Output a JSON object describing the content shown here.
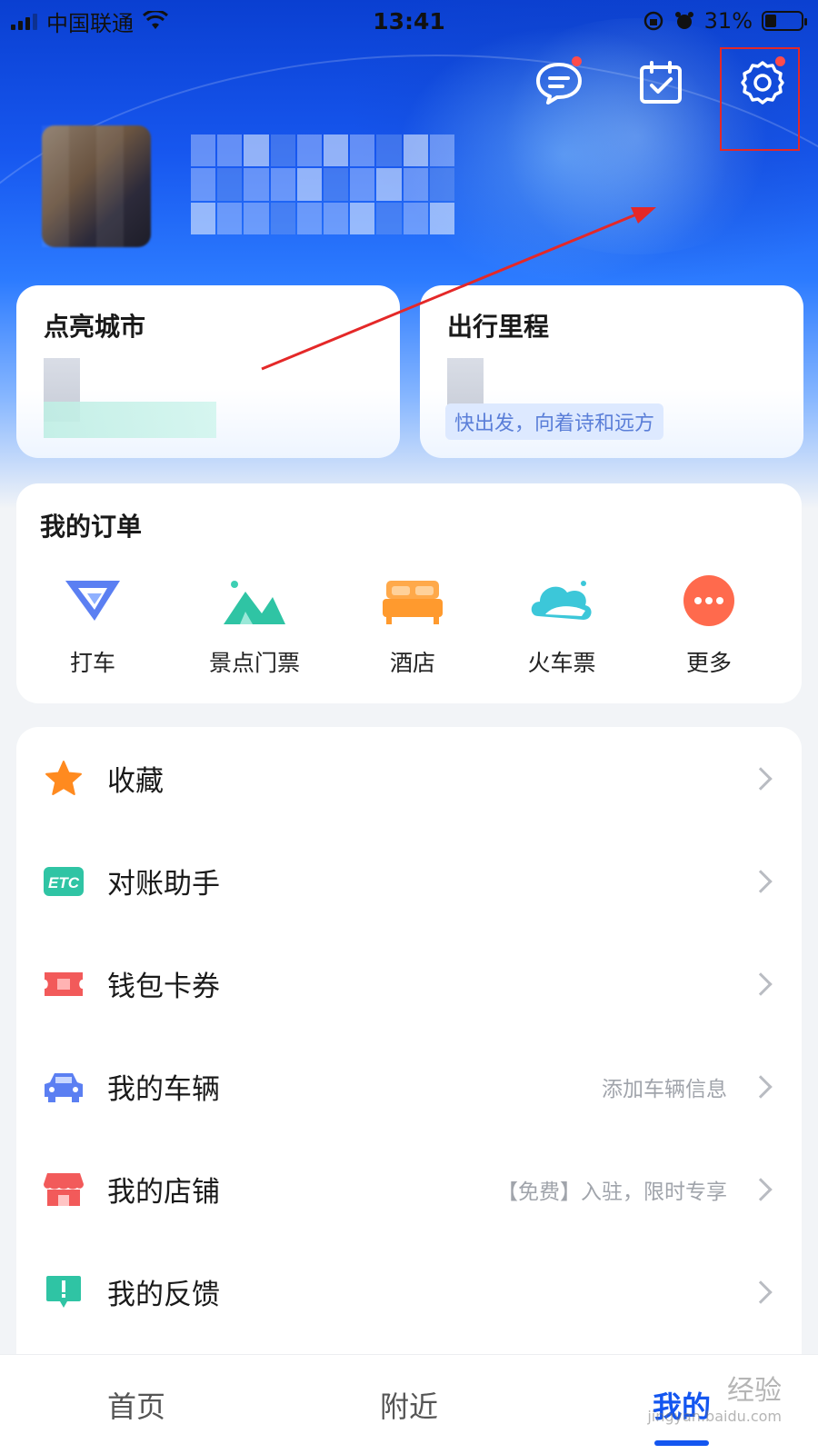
{
  "status_bar": {
    "carrier": "中国联通",
    "time": "13:41",
    "battery": "31%",
    "battery_level": 0.31
  },
  "header": {
    "icons": [
      "message-icon",
      "checkin-icon",
      "settings-icon"
    ]
  },
  "stats": {
    "left_title": "点亮城市",
    "right_title": "出行里程",
    "right_subtitle": "快出发，向着诗和远方"
  },
  "orders": {
    "title": "我的订单",
    "items": [
      {
        "label": "打车",
        "icon": "taxi-icon"
      },
      {
        "label": "景点门票",
        "icon": "scenic-ticket-icon"
      },
      {
        "label": "酒店",
        "icon": "hotel-bed-icon"
      },
      {
        "label": "火车票",
        "icon": "train-ticket-icon"
      },
      {
        "label": "更多",
        "icon": "more-icon"
      }
    ]
  },
  "menu": {
    "items": [
      {
        "label": "收藏",
        "hint": "",
        "icon": "star-icon"
      },
      {
        "label": "对账助手",
        "hint": "",
        "icon": "etc-icon"
      },
      {
        "label": "钱包卡券",
        "hint": "",
        "icon": "coupon-icon"
      },
      {
        "label": "我的车辆",
        "hint": "添加车辆信息",
        "icon": "car-icon"
      },
      {
        "label": "我的店铺",
        "hint": "【免费】入驻，限时专享",
        "icon": "store-icon"
      },
      {
        "label": "我的反馈",
        "hint": "",
        "icon": "feedback-icon"
      }
    ]
  },
  "tabbar": {
    "tabs": [
      "首页",
      "附近",
      "我的"
    ]
  },
  "watermark": {
    "brand": "经验",
    "url": "jingyan.baidu.com"
  },
  "colors": {
    "accent": "#1456f0",
    "highlight": "#e42828"
  }
}
